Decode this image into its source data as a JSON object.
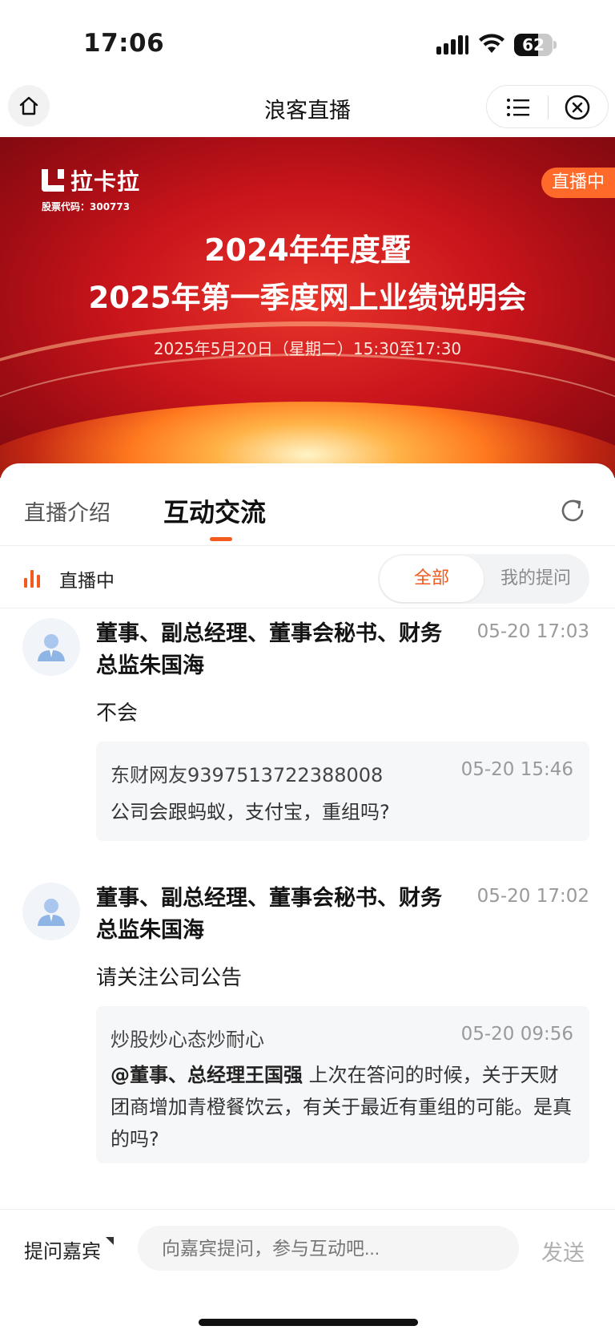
{
  "status_bar": {
    "time": "17:06",
    "battery": "62",
    "battery_level": 0.62
  },
  "nav": {
    "title": "浪客直播"
  },
  "banner": {
    "brand_name": "拉卡拉",
    "stock_code": "股票代码：300773",
    "live_badge": "直播中",
    "title_line1": "2024年年度暨",
    "title_line2": "2025年第一季度网上业绩说明会",
    "datetime": "2025年5月20日（星期二）15:30至17:30"
  },
  "tabs": [
    {
      "label": "直播介绍",
      "active": false
    },
    {
      "label": "互动交流",
      "active": true
    }
  ],
  "filter": {
    "status": "直播中",
    "all": "全部",
    "mine": "我的提问",
    "selected": "全部"
  },
  "posts": [
    {
      "author": "董事、副总经理、董事会秘书、财务总监朱国海",
      "time": "05-20 17:03",
      "answer": "不会",
      "question": {
        "user": "东财网友9397513722388008",
        "time": "05-20 15:46",
        "mention": "",
        "text": "公司会跟蚂蚁，支付宝，重组吗?"
      }
    },
    {
      "author": "董事、副总经理、董事会秘书、财务总监朱国海",
      "time": "05-20 17:02",
      "answer": "请关注公司公告",
      "question": {
        "user": "炒股炒心态炒耐心",
        "time": "05-20 09:56",
        "mention": "@董事、总经理王国强",
        "text": " 上次在答问的时候，关于天财团商增加青橙餐饮云，有关于最近有重组的可能。是真的吗?"
      }
    }
  ],
  "input_bar": {
    "ask_guest": "提问嘉宾",
    "placeholder": "向嘉宾提问，参与互动吧...",
    "send": "发送"
  },
  "colors": {
    "accent": "#f25a1e",
    "banner_red": "#c8141b",
    "live_badge": "#ff6a2a"
  }
}
